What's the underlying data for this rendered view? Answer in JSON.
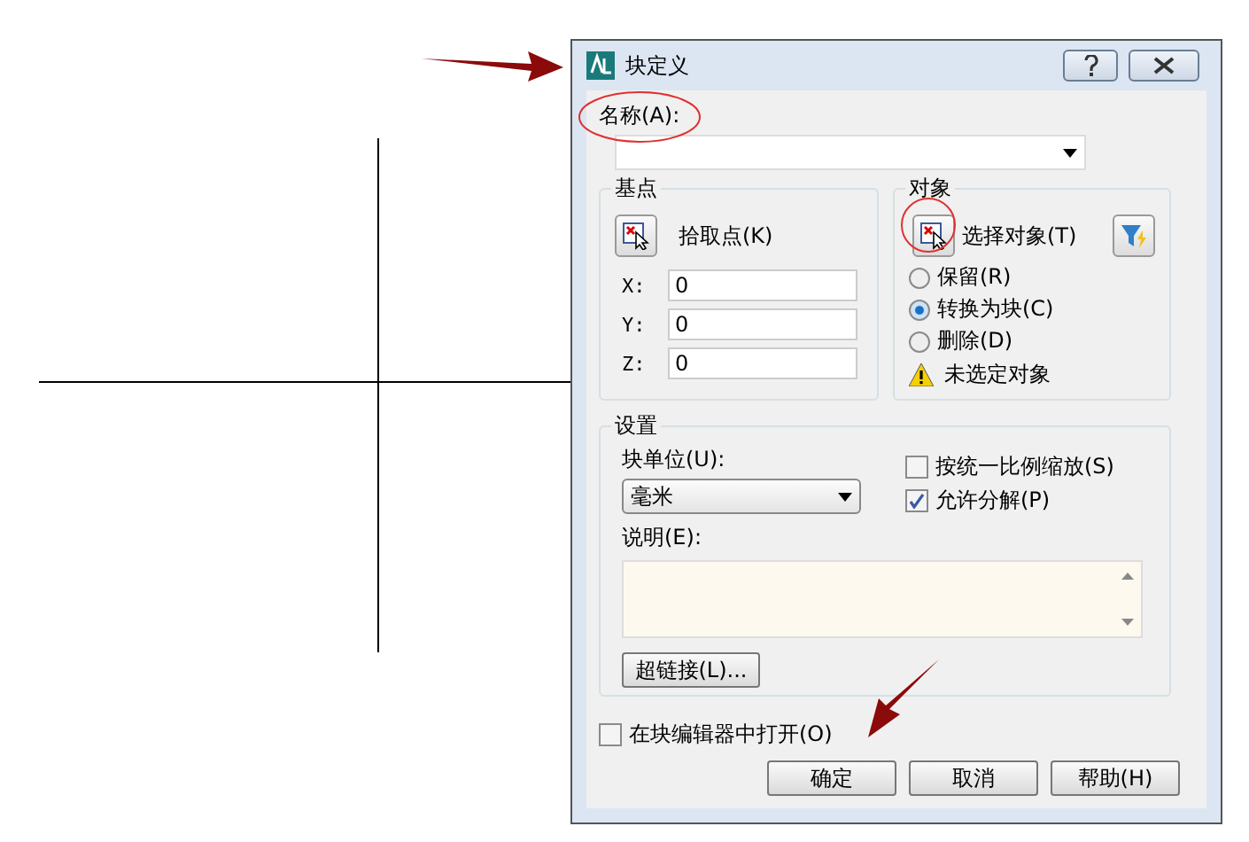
{
  "window": {
    "title": "块定义"
  },
  "name": {
    "label": "名称(A):"
  },
  "base_point": {
    "title": "基点",
    "pick_button": "拾取点(K)",
    "coords": [
      {
        "label": "X:",
        "value": "0"
      },
      {
        "label": "Y:",
        "value": "0"
      },
      {
        "label": "Z:",
        "value": "0"
      }
    ]
  },
  "objects": {
    "title": "对象",
    "select_button": "选择对象(T)",
    "options": [
      {
        "label": "保留(R)",
        "selected": false
      },
      {
        "label": "转换为块(C)",
        "selected": true
      },
      {
        "label": "删除(D)",
        "selected": false
      }
    ],
    "warning": "未选定对象"
  },
  "settings": {
    "title": "设置",
    "unit_label": "块单位(U):",
    "unit_value": "毫米",
    "checks": [
      {
        "label": "按统一比例缩放(S)",
        "checked": false
      },
      {
        "label": "允许分解(P)",
        "checked": true
      }
    ],
    "description_label": "说明(E):",
    "hyperlink_button": "超链接(L)..."
  },
  "open_in_editor": {
    "label": "在块编辑器中打开(O)",
    "checked": false
  },
  "buttons": [
    "确定",
    "取消",
    "帮助(H)"
  ]
}
